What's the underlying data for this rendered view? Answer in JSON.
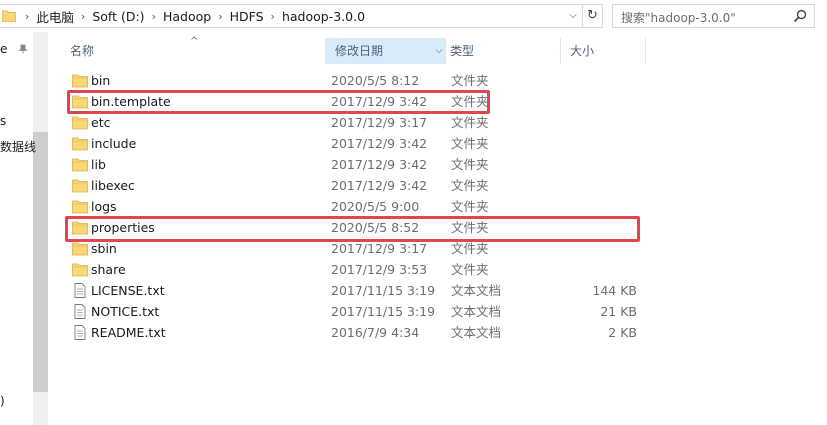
{
  "address": {
    "breadcrumb": [
      "此电脑",
      "Soft (D:)",
      "Hadoop",
      "HDFS",
      "hadoop-3.0.0"
    ]
  },
  "search": {
    "placeholder": "搜索\"hadoop-3.0.0\""
  },
  "nav": {
    "fragments": [
      "e",
      "s",
      "数据线",
      ")"
    ]
  },
  "columns": {
    "name": "名称",
    "date": "修改日期",
    "type": "类型",
    "size": "大小"
  },
  "files": [
    {
      "name": "bin",
      "date": "2020/5/5 8:12",
      "type": "文件夹",
      "size": "",
      "icon": "folder-icon"
    },
    {
      "name": "bin.template",
      "date": "2017/12/9 3:42",
      "type": "文件夹",
      "size": "",
      "icon": "folder-icon"
    },
    {
      "name": "etc",
      "date": "2017/12/9 3:17",
      "type": "文件夹",
      "size": "",
      "icon": "folder-icon"
    },
    {
      "name": "include",
      "date": "2017/12/9 3:42",
      "type": "文件夹",
      "size": "",
      "icon": "folder-icon"
    },
    {
      "name": "lib",
      "date": "2017/12/9 3:42",
      "type": "文件夹",
      "size": "",
      "icon": "folder-icon"
    },
    {
      "name": "libexec",
      "date": "2017/12/9 3:42",
      "type": "文件夹",
      "size": "",
      "icon": "folder-icon"
    },
    {
      "name": "logs",
      "date": "2020/5/5 9:00",
      "type": "文件夹",
      "size": "",
      "icon": "folder-icon"
    },
    {
      "name": "properties",
      "date": "2020/5/5 8:52",
      "type": "文件夹",
      "size": "",
      "icon": "folder-icon"
    },
    {
      "name": "sbin",
      "date": "2017/12/9 3:17",
      "type": "文件夹",
      "size": "",
      "icon": "folder-icon"
    },
    {
      "name": "share",
      "date": "2017/12/9 3:53",
      "type": "文件夹",
      "size": "",
      "icon": "folder-icon"
    },
    {
      "name": "LICENSE.txt",
      "date": "2017/11/15 3:19",
      "type": "文本文档",
      "size": "144 KB",
      "icon": "text-file-icon"
    },
    {
      "name": "NOTICE.txt",
      "date": "2017/11/15 3:19",
      "type": "文本文档",
      "size": "21 KB",
      "icon": "text-file-icon"
    },
    {
      "name": "README.txt",
      "date": "2016/7/9 4:34",
      "type": "文本文档",
      "size": "2 KB",
      "icon": "text-file-icon"
    }
  ],
  "colors": {
    "highlight": "#e0464b",
    "folder": "#f8d775",
    "sorted_header": "#d9ebf9"
  }
}
